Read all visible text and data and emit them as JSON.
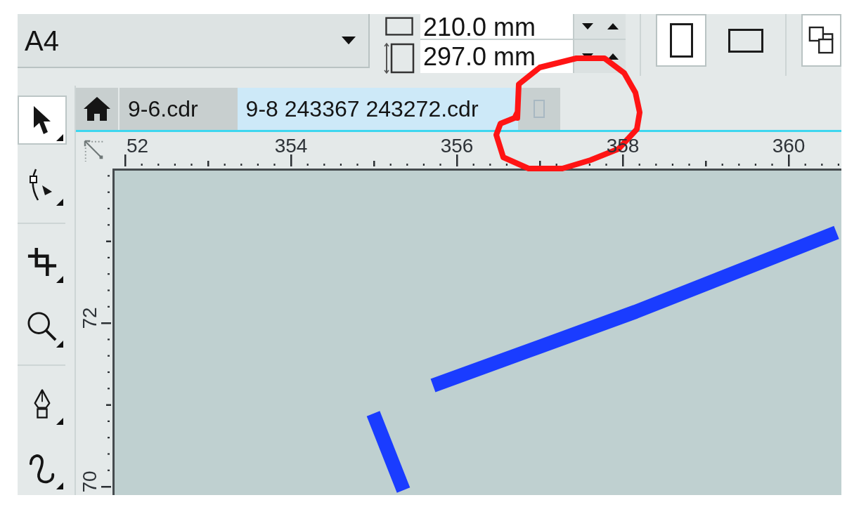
{
  "property_bar": {
    "page_size": {
      "value": "A4"
    },
    "page_width": {
      "value": "210.0 mm"
    },
    "page_height": {
      "value": "297.0 mm"
    },
    "orientation": [
      {
        "kind": "portrait",
        "selected": true
      },
      {
        "kind": "landscape",
        "selected": false
      }
    ]
  },
  "toolbox": {
    "groups": [
      {
        "tools": [
          {
            "kind": "pick",
            "selected": true
          },
          {
            "kind": "shape",
            "selected": false
          }
        ]
      },
      {
        "tools": [
          {
            "kind": "crop",
            "selected": false
          },
          {
            "kind": "zoom",
            "selected": false
          }
        ]
      },
      {
        "tools": [
          {
            "kind": "pen",
            "selected": false
          },
          {
            "kind": "artistic-media",
            "selected": false
          }
        ]
      }
    ]
  },
  "document_tabs": [
    {
      "kind": "home",
      "selected": false
    },
    {
      "kind": "document",
      "label": "9-6.cdr",
      "selected": false
    },
    {
      "kind": "document",
      "label": "9-8 243367 243272.cdr",
      "selected": true
    }
  ],
  "horizontal_ruler": {
    "labels": [
      "52",
      "354",
      "356",
      "358",
      "360"
    ]
  },
  "vertical_ruler": {
    "labels": [
      "72",
      "70"
    ]
  }
}
